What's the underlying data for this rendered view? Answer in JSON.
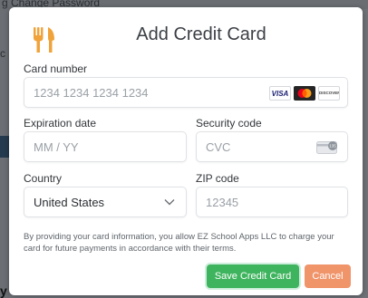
{
  "background": {
    "top_text": "g        Change Password",
    "left_char": "c",
    "bottom_mark": "y"
  },
  "modal": {
    "title": "Add Credit Card",
    "logo_icon": "fork-knife-icon",
    "accent_color": "#f0a33a"
  },
  "form": {
    "card_number": {
      "label": "Card number",
      "placeholder": "1234 1234 1234 1234",
      "brands": [
        "VISA",
        "mastercard",
        "DISCOVER"
      ]
    },
    "expiration": {
      "label": "Expiration date",
      "placeholder": "MM / YY"
    },
    "security_code": {
      "label": "Security code",
      "placeholder": "CVC",
      "icon_text": "135"
    },
    "country": {
      "label": "Country",
      "value": "United States"
    },
    "zip": {
      "label": "ZIP code",
      "placeholder": "12345"
    }
  },
  "disclaimer": "By providing your card information, you allow EZ School Apps LLC to charge your card for future payments in accordance with their terms.",
  "buttons": {
    "save": "Save Credit Card",
    "cancel": "Cancel"
  },
  "colors": {
    "save_button": "#3fb45e",
    "cancel_button": "#f0946a"
  }
}
